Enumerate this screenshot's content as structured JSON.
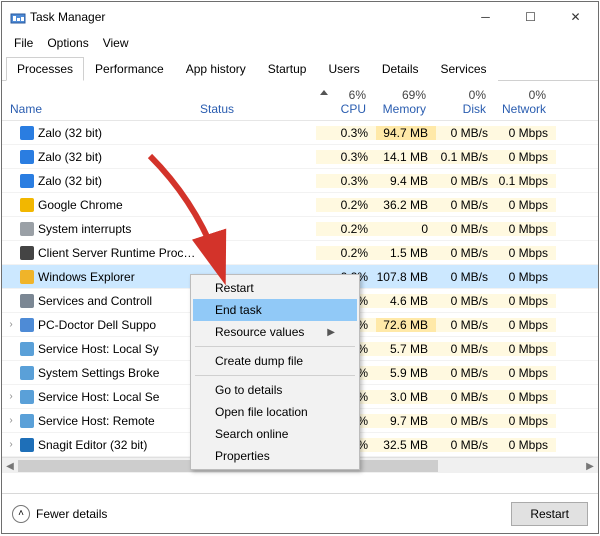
{
  "window": {
    "title": "Task Manager"
  },
  "menubar": [
    "File",
    "Options",
    "View"
  ],
  "tabs": [
    "Processes",
    "Performance",
    "App history",
    "Startup",
    "Users",
    "Details",
    "Services"
  ],
  "active_tab": 0,
  "columns": {
    "name": "Name",
    "status": "Status",
    "cpu": {
      "pct": "6%",
      "label": "CPU"
    },
    "memory": {
      "pct": "69%",
      "label": "Memory"
    },
    "disk": {
      "pct": "0%",
      "label": "Disk"
    },
    "network": {
      "pct": "0%",
      "label": "Network"
    }
  },
  "rows": [
    {
      "exp": "",
      "icon": "zalo-icon",
      "name": "Zalo (32 bit)",
      "cpu": "0.3%",
      "mem": "94.7 MB",
      "disk": "0 MB/s",
      "net": "0 Mbps",
      "heat_mem": "med"
    },
    {
      "exp": "",
      "icon": "zalo-icon",
      "name": "Zalo (32 bit)",
      "cpu": "0.3%",
      "mem": "14.1 MB",
      "disk": "0.1 MB/s",
      "net": "0 Mbps",
      "heat_mem": "low"
    },
    {
      "exp": "",
      "icon": "zalo-icon",
      "name": "Zalo (32 bit)",
      "cpu": "0.3%",
      "mem": "9.4 MB",
      "disk": "0 MB/s",
      "net": "0.1 Mbps",
      "heat_mem": "low"
    },
    {
      "exp": "",
      "icon": "chrome-icon",
      "name": "Google Chrome",
      "cpu": "0.2%",
      "mem": "36.2 MB",
      "disk": "0 MB/s",
      "net": "0 Mbps",
      "heat_mem": "low"
    },
    {
      "exp": "",
      "icon": "system-icon",
      "name": "System interrupts",
      "cpu": "0.2%",
      "mem": "0",
      "disk": "0 MB/s",
      "net": "0 Mbps",
      "heat_mem": "low"
    },
    {
      "exp": "",
      "icon": "console-icon",
      "name": "Client Server Runtime Process",
      "cpu": "0.2%",
      "mem": "1.5 MB",
      "disk": "0 MB/s",
      "net": "0 Mbps",
      "heat_mem": "low"
    },
    {
      "exp": "",
      "icon": "explorer-icon",
      "name": "Windows Explorer",
      "cpu": "0.2%",
      "mem": "107.8 MB",
      "disk": "0 MB/s",
      "net": "0 Mbps",
      "heat_mem": "med",
      "selected": true
    },
    {
      "exp": "",
      "icon": "service-icon",
      "name": "Services and Controll",
      "cpu": "0.2%",
      "mem": "4.6 MB",
      "disk": "0 MB/s",
      "net": "0 Mbps",
      "heat_mem": "low"
    },
    {
      "exp": "›",
      "icon": "pcdoctor-icon",
      "name": "PC-Doctor Dell Suppo",
      "cpu": "0.2%",
      "mem": "72.6 MB",
      "disk": "0 MB/s",
      "net": "0 Mbps",
      "heat_mem": "med"
    },
    {
      "exp": "",
      "icon": "gear-icon",
      "name": "Service Host: Local Sy",
      "cpu": "0.2%",
      "mem": "5.7 MB",
      "disk": "0 MB/s",
      "net": "0 Mbps",
      "heat_mem": "low"
    },
    {
      "exp": "",
      "icon": "gear-icon",
      "name": "System Settings Broke",
      "cpu": "0.2%",
      "mem": "5.9 MB",
      "disk": "0 MB/s",
      "net": "0 Mbps",
      "heat_mem": "low"
    },
    {
      "exp": "›",
      "icon": "gear-icon",
      "name": "Service Host: Local Se",
      "cpu": "0.2%",
      "mem": "3.0 MB",
      "disk": "0 MB/s",
      "net": "0 Mbps",
      "heat_mem": "low"
    },
    {
      "exp": "›",
      "icon": "gear-icon",
      "name": "Service Host: Remote",
      "cpu": "0.2%",
      "mem": "9.7 MB",
      "disk": "0 MB/s",
      "net": "0 Mbps",
      "heat_mem": "low"
    },
    {
      "exp": "›",
      "icon": "snagit-icon",
      "name": "Snagit Editor (32 bit)",
      "cpu": "0%",
      "mem": "32.5 MB",
      "disk": "0 MB/s",
      "net": "0 Mbps",
      "heat_mem": "low"
    }
  ],
  "context_menu": [
    {
      "label": "Restart",
      "type": "item"
    },
    {
      "label": "End task",
      "type": "item",
      "highlight": true
    },
    {
      "label": "Resource values",
      "type": "submenu"
    },
    {
      "type": "sep"
    },
    {
      "label": "Create dump file",
      "type": "item"
    },
    {
      "type": "sep"
    },
    {
      "label": "Go to details",
      "type": "item"
    },
    {
      "label": "Open file location",
      "type": "item"
    },
    {
      "label": "Search online",
      "type": "item"
    },
    {
      "label": "Properties",
      "type": "item"
    }
  ],
  "footer": {
    "fewer": "Fewer details",
    "button": "Restart"
  },
  "icon_colors": {
    "zalo-icon": "#2a7de1",
    "chrome-icon": "#f2b700",
    "system-icon": "#9aa0a6",
    "console-icon": "#444444",
    "explorer-icon": "#f0b429",
    "service-icon": "#7b8794",
    "pcdoctor-icon": "#4e8bd6",
    "gear-icon": "#5aa0d8",
    "snagit-icon": "#1e6fb8"
  }
}
